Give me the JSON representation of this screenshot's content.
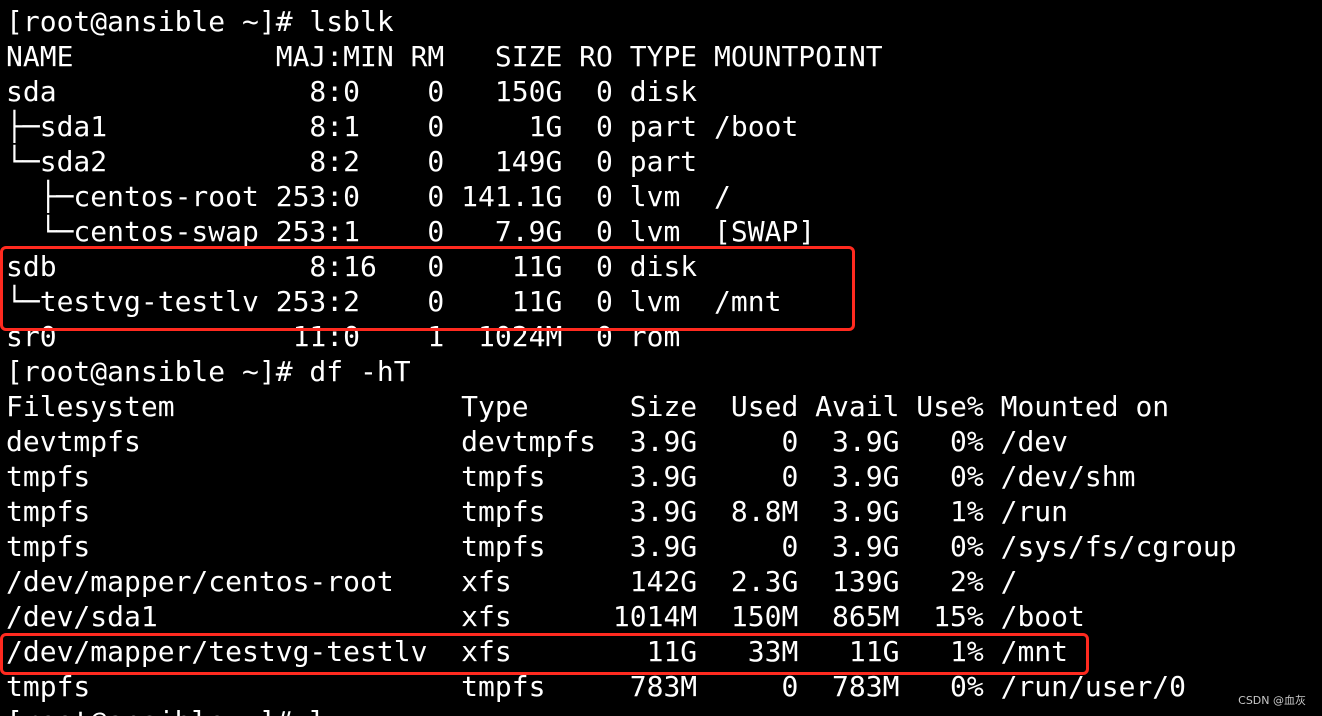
{
  "terminal": {
    "lines": [
      "[root@ansible ~]# lsblk",
      "NAME            MAJ:MIN RM   SIZE RO TYPE MOUNTPOINT",
      "sda               8:0    0   150G  0 disk",
      "├─sda1            8:1    0     1G  0 part /boot",
      "└─sda2            8:2    0   149G  0 part",
      "  ├─centos-root 253:0    0 141.1G  0 lvm  /",
      "  └─centos-swap 253:1    0   7.9G  0 lvm  [SWAP]",
      "sdb               8:16   0    11G  0 disk",
      "└─testvg-testlv 253:2    0    11G  0 lvm  /mnt",
      "sr0              11:0    1  1024M  0 rom",
      "[root@ansible ~]# df -hT",
      "Filesystem                 Type      Size  Used Avail Use% Mounted on",
      "devtmpfs                   devtmpfs  3.9G     0  3.9G   0% /dev",
      "tmpfs                      tmpfs     3.9G     0  3.9G   0% /dev/shm",
      "tmpfs                      tmpfs     3.9G  8.8M  3.9G   1% /run",
      "tmpfs                      tmpfs     3.9G     0  3.9G   0% /sys/fs/cgroup",
      "/dev/mapper/centos-root    xfs       142G  2.3G  139G   2% /",
      "/dev/sda1                  xfs      1014M  150M  865M  15% /boot",
      "/dev/mapper/testvg-testlv  xfs        11G   33M   11G   1% /mnt",
      "tmpfs                      tmpfs     783M     0  783M   0% /run/user/0",
      "[root@ansible ~]# l"
    ],
    "text_color": "#ffffff",
    "background_color": "#000000"
  },
  "highlights": {
    "color": "#ff2a1f",
    "items": [
      "lsblk-sdb-rows",
      "df-testlv-row"
    ]
  },
  "watermark": {
    "text": "CSDN @血灰"
  }
}
